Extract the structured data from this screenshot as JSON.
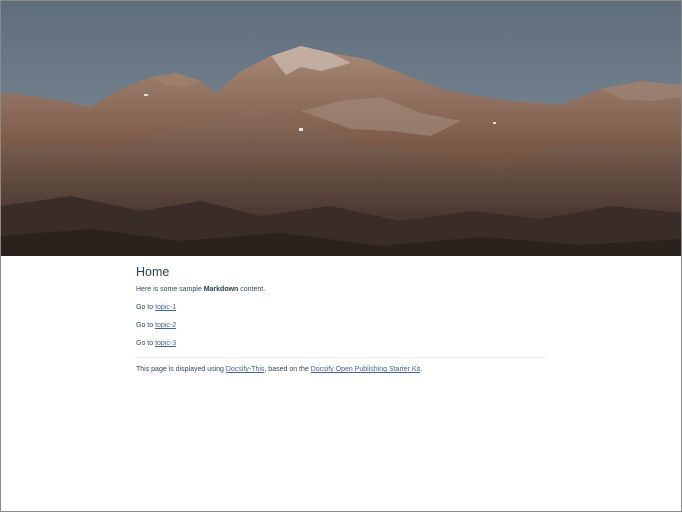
{
  "page": {
    "title": "Home",
    "intro": {
      "before": "Here is some sample ",
      "bold": "Markdown",
      "after": " content."
    },
    "links": [
      {
        "prefix": "Go to ",
        "label": "topic-1"
      },
      {
        "prefix": "Go to ",
        "label": "topic-2"
      },
      {
        "prefix": "Go to ",
        "label": "topic-3"
      }
    ],
    "footer": {
      "text1": "This page is displayed using ",
      "link1": "Docsify-This",
      "text2": ", based on the ",
      "link2": "Docsify Open Publishing Starter Kit",
      "text3": "."
    }
  },
  "colors": {
    "link": "#42649a",
    "heading": "#2c3e50",
    "text": "#34495e",
    "sky": "#6a7886",
    "mountain": "#8a6a58"
  }
}
